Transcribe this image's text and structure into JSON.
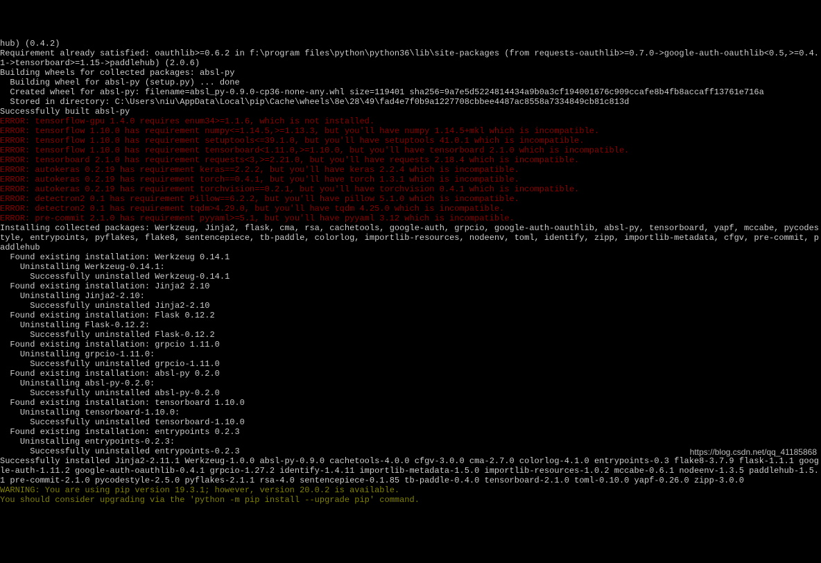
{
  "lines": [
    {
      "cls": "",
      "t": "hub) (0.4.2)"
    },
    {
      "cls": "",
      "t": "Requirement already satisfied: oauthlib>=0.6.2 in f:\\program files\\python\\python36\\lib\\site-packages (from requests-oauthlib>=0.7.0->google-auth-oauthlib<0.5,>=0.4.1->tensorboard>=1.15->paddlehub) (2.0.6)"
    },
    {
      "cls": "",
      "t": "Building wheels for collected packages: absl-py"
    },
    {
      "cls": "",
      "t": "  Building wheel for absl-py (setup.py) ... done"
    },
    {
      "cls": "",
      "t": "  Created wheel for absl-py: filename=absl_py-0.9.0-cp36-none-any.whl size=119401 sha256=9a7e5d5224814434a9b0a3cf194001676c909ccafe8b4fb8accaff13761e716a"
    },
    {
      "cls": "",
      "t": "  Stored in directory: C:\\Users\\niu\\AppData\\Local\\pip\\Cache\\wheels\\8e\\28\\49\\fad4e7f0b9a1227708cbbee4487ac8558a7334849cb81c813d"
    },
    {
      "cls": "",
      "t": "Successfully built absl-py"
    },
    {
      "cls": "err",
      "t": "ERROR: tensorflow-gpu 1.4.0 requires enum34>=1.1.6, which is not installed."
    },
    {
      "cls": "err",
      "t": "ERROR: tensorflow 1.10.0 has requirement numpy<=1.14.5,>=1.13.3, but you'll have numpy 1.14.5+mkl which is incompatible."
    },
    {
      "cls": "err",
      "t": "ERROR: tensorflow 1.10.0 has requirement setuptools<=39.1.0, but you'll have setuptools 41.0.1 which is incompatible."
    },
    {
      "cls": "err",
      "t": "ERROR: tensorflow 1.10.0 has requirement tensorboard<1.11.0,>=1.10.0, but you'll have tensorboard 2.1.0 which is incompatible."
    },
    {
      "cls": "err",
      "t": "ERROR: tensorboard 2.1.0 has requirement requests<3,>=2.21.0, but you'll have requests 2.18.4 which is incompatible."
    },
    {
      "cls": "err",
      "t": "ERROR: autokeras 0.2.19 has requirement keras==2.2.2, but you'll have keras 2.2.4 which is incompatible."
    },
    {
      "cls": "err",
      "t": "ERROR: autokeras 0.2.19 has requirement torch==0.4.1, but you'll have torch 1.3.1 which is incompatible."
    },
    {
      "cls": "err",
      "t": "ERROR: autokeras 0.2.19 has requirement torchvision==0.2.1, but you'll have torchvision 0.4.1 which is incompatible."
    },
    {
      "cls": "err",
      "t": "ERROR: detectron2 0.1 has requirement Pillow==6.2.2, but you'll have pillow 5.1.0 which is incompatible."
    },
    {
      "cls": "err",
      "t": "ERROR: detectron2 0.1 has requirement tqdm>4.29.0, but you'll have tqdm 4.25.0 which is incompatible."
    },
    {
      "cls": "err",
      "t": "ERROR: pre-commit 2.1.0 has requirement pyyaml>=5.1, but you'll have pyyaml 3.12 which is incompatible."
    },
    {
      "cls": "",
      "t": "Installing collected packages: Werkzeug, Jinja2, flask, cma, rsa, cachetools, google-auth, grpcio, google-auth-oauthlib, absl-py, tensorboard, yapf, mccabe, pycodestyle, entrypoints, pyflakes, flake8, sentencepiece, tb-paddle, colorlog, importlib-resources, nodeenv, toml, identify, zipp, importlib-metadata, cfgv, pre-commit, paddlehub"
    },
    {
      "cls": "",
      "t": "  Found existing installation: Werkzeug 0.14.1"
    },
    {
      "cls": "",
      "t": "    Uninstalling Werkzeug-0.14.1:"
    },
    {
      "cls": "",
      "t": "      Successfully uninstalled Werkzeug-0.14.1"
    },
    {
      "cls": "",
      "t": "  Found existing installation: Jinja2 2.10"
    },
    {
      "cls": "",
      "t": "    Uninstalling Jinja2-2.10:"
    },
    {
      "cls": "",
      "t": "      Successfully uninstalled Jinja2-2.10"
    },
    {
      "cls": "",
      "t": "  Found existing installation: Flask 0.12.2"
    },
    {
      "cls": "",
      "t": "    Uninstalling Flask-0.12.2:"
    },
    {
      "cls": "",
      "t": "      Successfully uninstalled Flask-0.12.2"
    },
    {
      "cls": "",
      "t": "  Found existing installation: grpcio 1.11.0"
    },
    {
      "cls": "",
      "t": "    Uninstalling grpcio-1.11.0:"
    },
    {
      "cls": "",
      "t": "      Successfully uninstalled grpcio-1.11.0"
    },
    {
      "cls": "",
      "t": "  Found existing installation: absl-py 0.2.0"
    },
    {
      "cls": "",
      "t": "    Uninstalling absl-py-0.2.0:"
    },
    {
      "cls": "",
      "t": "      Successfully uninstalled absl-py-0.2.0"
    },
    {
      "cls": "",
      "t": "  Found existing installation: tensorboard 1.10.0"
    },
    {
      "cls": "",
      "t": "    Uninstalling tensorboard-1.10.0:"
    },
    {
      "cls": "",
      "t": "      Successfully uninstalled tensorboard-1.10.0"
    },
    {
      "cls": "",
      "t": "  Found existing installation: entrypoints 0.2.3"
    },
    {
      "cls": "",
      "t": "    Uninstalling entrypoints-0.2.3:"
    },
    {
      "cls": "",
      "t": "      Successfully uninstalled entrypoints-0.2.3"
    },
    {
      "cls": "",
      "t": "Successfully installed Jinja2-2.11.1 Werkzeug-1.0.0 absl-py-0.9.0 cachetools-4.0.0 cfgv-3.0.0 cma-2.7.0 colorlog-4.1.0 entrypoints-0.3 flake8-3.7.9 flask-1.1.1 google-auth-1.11.2 google-auth-oauthlib-0.4.1 grpcio-1.27.2 identify-1.4.11 importlib-metadata-1.5.0 importlib-resources-1.0.2 mccabe-0.6.1 nodeenv-1.3.5 paddlehub-1.5.1 pre-commit-2.1.0 pycodestyle-2.5.0 pyflakes-2.1.1 rsa-4.0 sentencepiece-0.1.85 tb-paddle-0.4.0 tensorboard-2.1.0 toml-0.10.0 yapf-0.26.0 zipp-3.0.0"
    },
    {
      "cls": "warn",
      "t": "WARNING: You are using pip version 19.3.1; however, version 20.0.2 is available."
    },
    {
      "cls": "warn",
      "t": "You should consider upgrading via the 'python -m pip install --upgrade pip' command."
    }
  ],
  "watermark": "https://blog.csdn.net/qq_41185868"
}
